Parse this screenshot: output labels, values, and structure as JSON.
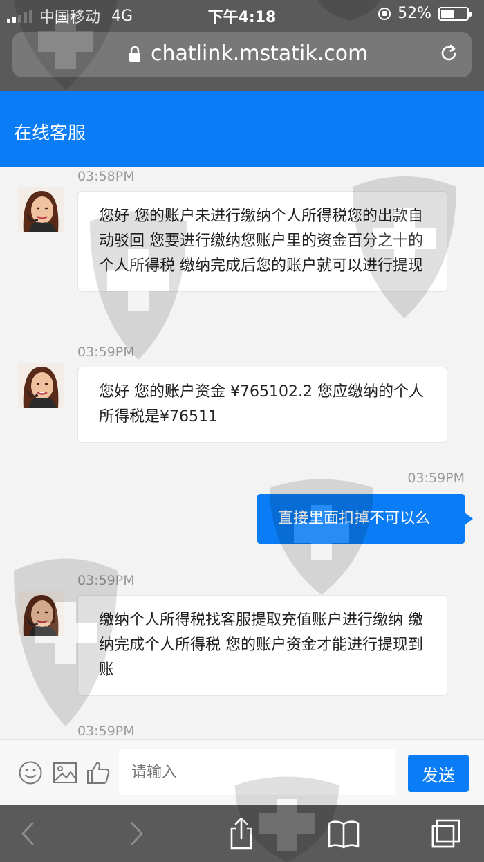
{
  "status_bar": {
    "carrier": "中国移动",
    "network": "4G",
    "time": "下午4:18",
    "battery": "52%",
    "battery_level": 0.52
  },
  "browser": {
    "url": "chatlink.mstatik.com"
  },
  "app": {
    "title": "在线客服"
  },
  "messages": [
    {
      "side": "left",
      "time": "03:58PM",
      "text": "您好 您的账户未进行缴纳个人所得税您的出款自动驳回 您要进行缴纳您账户里的资金百分之十的个人所得税 缴纳完成后您的账户就可以进行提现"
    },
    {
      "side": "left",
      "time": "03:59PM",
      "text": "您好 您的账户资金 ¥765102.2 您应缴纳的个人所得税是¥76511"
    },
    {
      "side": "right",
      "time": "03:59PM",
      "text": "直接里面扣掉不可以么"
    },
    {
      "side": "left",
      "time": "03:59PM",
      "text": "缴纳个人所得税找客服提取充值账户进行缴纳 缴纳完成个人所得税 您的账户资金才能进行提现到账"
    },
    {
      "side": "left",
      "time": "03:59PM",
      "text": ""
    }
  ],
  "composer": {
    "placeholder": "请输入",
    "send_label": "发送"
  },
  "colors": {
    "accent": "#0a7cf5",
    "chrome": "#5a5a5a"
  }
}
